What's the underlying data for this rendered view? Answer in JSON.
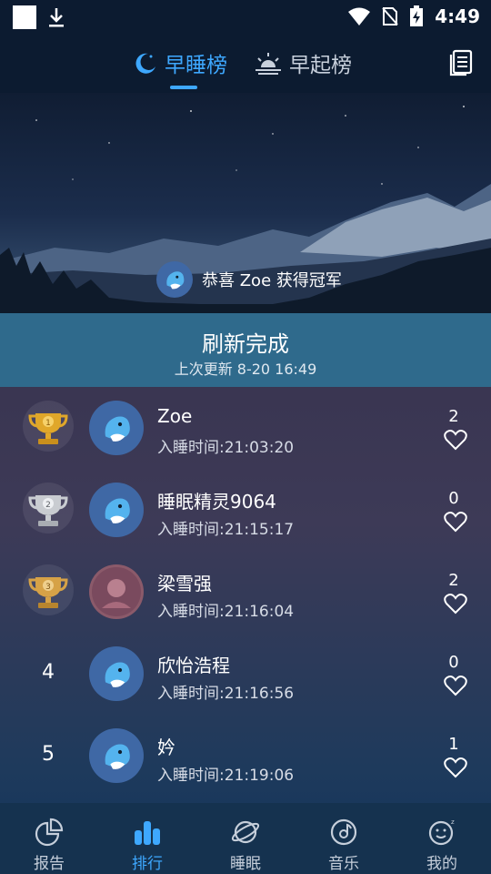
{
  "status_bar": {
    "time": "4:49"
  },
  "top_nav": {
    "tabs": [
      {
        "label": "早睡榜",
        "active": true
      },
      {
        "label": "早起榜",
        "active": false
      }
    ]
  },
  "banner": {
    "champion_text": "恭喜 Zoe 获得冠军"
  },
  "refresh": {
    "title": "刷新完成",
    "subtitle": "上次更新 8-20 16:49"
  },
  "ranking": [
    {
      "rank": "1",
      "name": "Zoe",
      "time": "入睡时间:21:03:20",
      "likes": "2",
      "trophy": "gold"
    },
    {
      "rank": "2",
      "name": "睡眠精灵9064",
      "time": "入睡时间:21:15:17",
      "likes": "0",
      "trophy": "silver"
    },
    {
      "rank": "3",
      "name": "梁雪强",
      "time": "入睡时间:21:16:04",
      "likes": "2",
      "trophy": "bronze"
    },
    {
      "rank": "4",
      "name": "欣怡浩程",
      "time": "入睡时间:21:16:56",
      "likes": "0",
      "trophy": ""
    },
    {
      "rank": "5",
      "name": "妗",
      "time": "入睡时间:21:19:06",
      "likes": "1",
      "trophy": ""
    }
  ],
  "bottom_nav": {
    "items": [
      {
        "label": "报告",
        "icon": "pie-chart-icon",
        "active": false
      },
      {
        "label": "排行",
        "icon": "bar-chart-icon",
        "active": true
      },
      {
        "label": "睡眠",
        "icon": "planet-icon",
        "active": false
      },
      {
        "label": "音乐",
        "icon": "music-disc-icon",
        "active": false
      },
      {
        "label": "我的",
        "icon": "smile-icon",
        "active": false
      }
    ]
  },
  "colors": {
    "accent": "#3ea8ff",
    "refresh_bar": "#2f6a8c",
    "nav_bg": "#0c1b30"
  }
}
